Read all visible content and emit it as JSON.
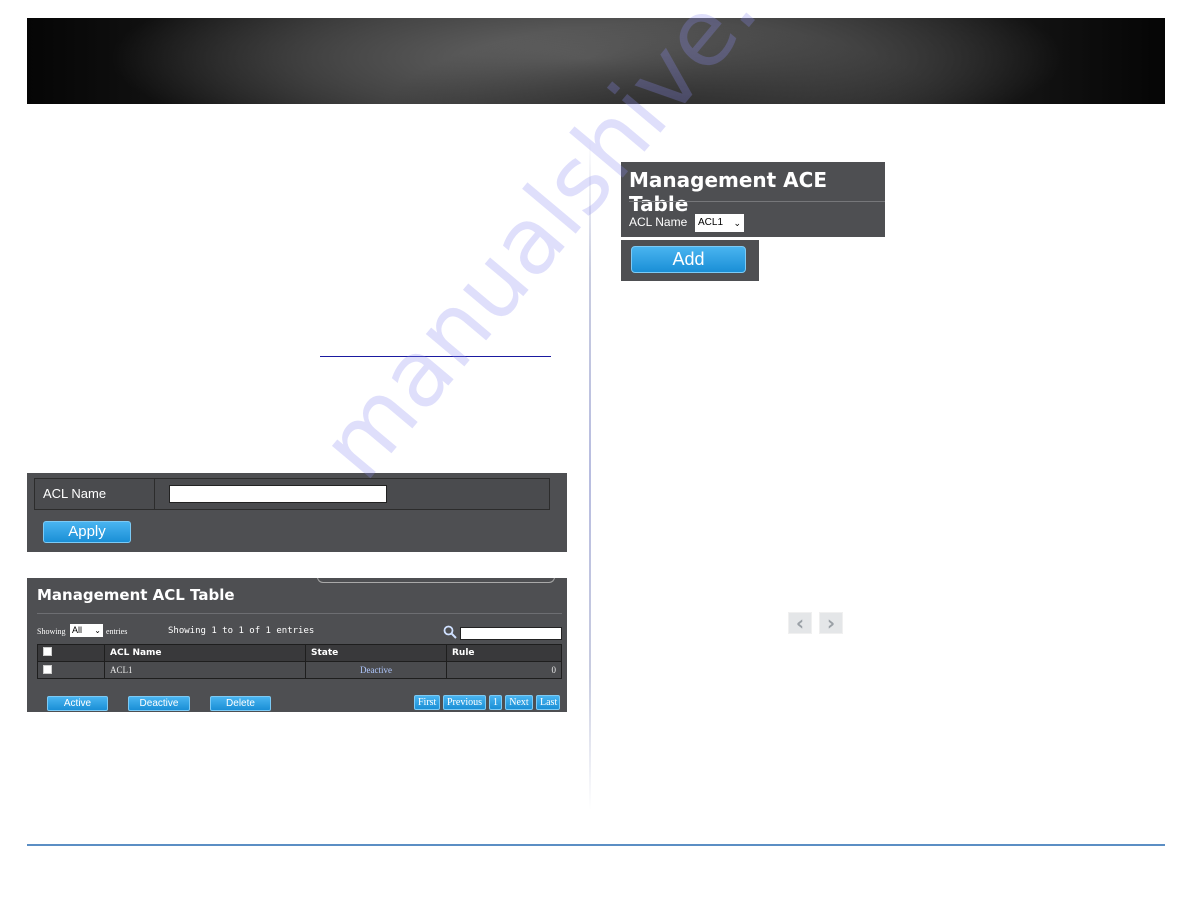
{
  "header": {
    "banner": "header-banner"
  },
  "colors": {
    "panel_bg": "#4e4f52",
    "button_blue": "#1a8fd6",
    "footer_rule": "#5b8ec4",
    "link": "#1a1aa0"
  },
  "watermark": "manualshive.com",
  "acl_form": {
    "name_label": "ACL Name",
    "name_value": "",
    "apply_label": "Apply"
  },
  "acl_table": {
    "title": "Management ACL Table",
    "showing_label": "Showing",
    "showing_select": "All",
    "entries_label": "entries",
    "info": "Showing 1 to 1 of 1 entries",
    "search_value": "",
    "columns": [
      "",
      "ACL Name",
      "State",
      "Rule"
    ],
    "rows": [
      {
        "acl_name": "ACL1",
        "state": "Deactive",
        "rule": "0"
      }
    ],
    "actions": {
      "active": "Active",
      "deactive": "Deactive",
      "delete": "Delete"
    },
    "pagination": {
      "first": "First",
      "previous": "Previous",
      "page": "1",
      "next": "Next",
      "last": "Last"
    }
  },
  "ace_table": {
    "title": "Management ACE Table",
    "acl_name_label": "ACL Name",
    "acl_name_selected": "ACL1",
    "add_label": "Add"
  },
  "nav": {
    "prev_glyph": "‹",
    "next_glyph": "›"
  }
}
